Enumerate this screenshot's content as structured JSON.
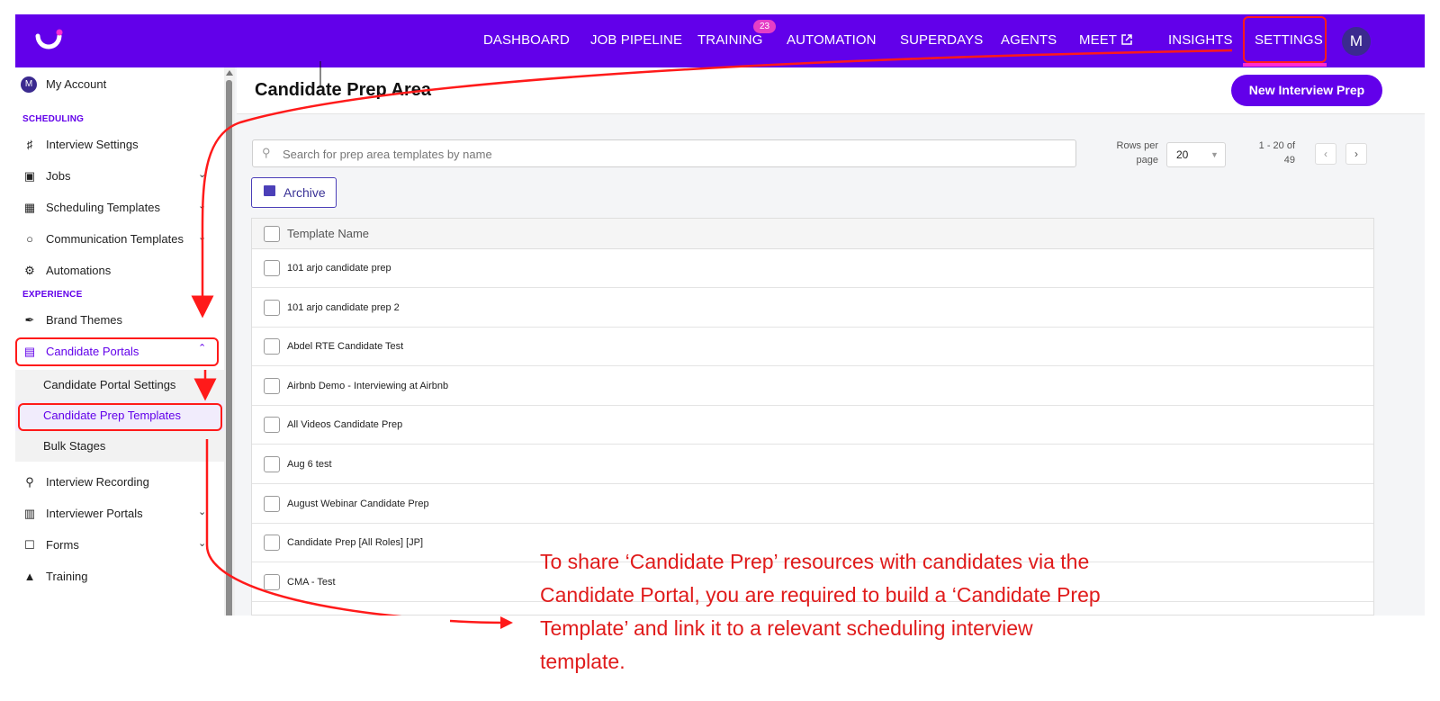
{
  "topnav": {
    "items": [
      "DASHBOARD",
      "JOB PIPELINE",
      "TRAINING",
      "AUTOMATION",
      "SUPERDAYS",
      "AGENTS",
      "MEET",
      "INSIGHTS",
      "SETTINGS"
    ],
    "training_badge": "23",
    "avatar": "M"
  },
  "sidebar": {
    "account": {
      "avatar": "M",
      "label": "My Account"
    },
    "section_scheduling": "SCHEDULING",
    "section_experience": "EXPERIENCE",
    "items": {
      "interview_settings": "Interview Settings",
      "jobs": "Jobs",
      "scheduling_templates": "Scheduling Templates",
      "communication_templates": "Communication Templates",
      "automations": "Automations",
      "brand_themes": "Brand Themes",
      "candidate_portals": "Candidate Portals",
      "candidate_portal_settings": "Candidate Portal Settings",
      "candidate_prep_templates": "Candidate Prep Templates",
      "bulk_stages": "Bulk Stages",
      "interview_recording": "Interview Recording",
      "interviewer_portals": "Interviewer Portals",
      "forms": "Forms",
      "training": "Training"
    }
  },
  "main": {
    "title": "Candidate Prep Area",
    "new_button": "New Interview Prep",
    "search_placeholder": "Search for prep area templates by name",
    "rows_per_page_label": "Rows per page",
    "rows_per_page_value": "20",
    "range_label": "1 - 20 of 49",
    "archive_label": "Archive",
    "table_header": "Template Name",
    "rows": [
      "101 arjo candidate prep",
      "101 arjo candidate prep 2",
      "Abdel RTE Candidate Test",
      "Airbnb Demo - Interviewing at Airbnb",
      "All Videos Candidate Prep",
      "Aug 6 test",
      "August Webinar Candidate Prep",
      "Candidate Prep [All Roles] [JP]",
      "CMA - Test"
    ]
  },
  "annotation": {
    "text": "To share ‘Candidate Prep’ resources with candidates via the Candidate Portal, you are required to build a ‘Candidate Prep Template’ and link it to a relevant scheduling interview template.",
    "color": "#e01b1b"
  },
  "colors": {
    "brand": "#6200ea",
    "badge": "#e53fc6",
    "highlight": "#ff1a1a"
  }
}
